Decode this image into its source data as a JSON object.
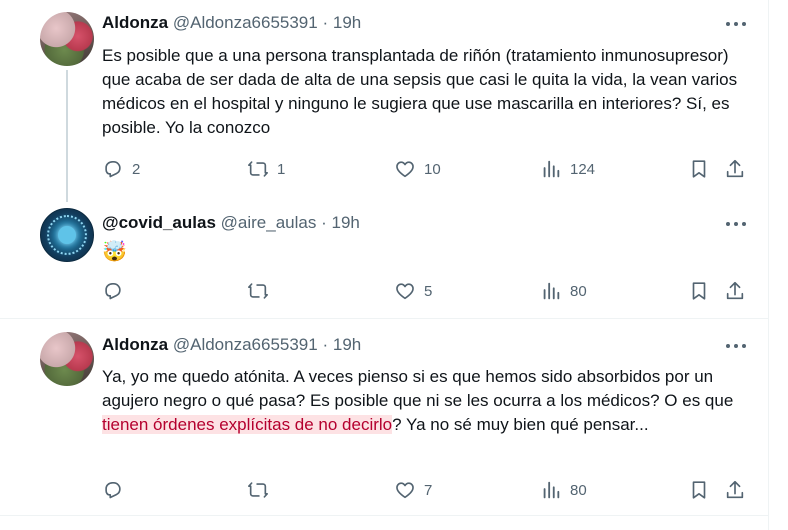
{
  "tweets": [
    {
      "author": "Aldonza",
      "handle": "@Aldonza6655391",
      "separator": "·",
      "time": "19h",
      "text": "Es posible que a una persona transplantada de riñón (tratamiento inmunosupresor) que acaba de ser dada de alta de una sepsis que casi le quita la vida, la vean varios médicos en el hospital y ninguno le sugiera que use mascarilla en interiores? Sí, es posible. Yo la conozco",
      "replies": "2",
      "retweets": "1",
      "likes": "10",
      "views": "124"
    },
    {
      "author": "@covid_aulas",
      "handle": "@aire_aulas",
      "separator": "·",
      "time": "19h",
      "emoji": "🤯",
      "replies": "",
      "retweets": "",
      "likes": "5",
      "views": "80"
    },
    {
      "author": "Aldonza",
      "handle": "@Aldonza6655391",
      "separator": "·",
      "time": "19h",
      "text_before": "Ya, yo me quedo atónita. A veces pienso si es que hemos sido absorbidos por un agujero negro o qué pasa? Es posible que ni se les ocurra a los médicos? O es que ",
      "text_highlight": "tienen órdenes explícitas de no decirlo",
      "text_after": "? Ya no sé muy bien qué pensar...",
      "replies": "",
      "retweets": "",
      "likes": "7",
      "views": "80"
    }
  ],
  "icons": {
    "reply": "reply-icon",
    "retweet": "retweet-icon",
    "like": "heart-icon",
    "views": "views-icon",
    "bookmark": "bookmark-icon",
    "share": "share-icon",
    "more": "more-icon"
  },
  "colors": {
    "text": "#0f1419",
    "secondary": "#536471",
    "highlight_bg": "#fde2e4",
    "highlight_text": "#b4002e",
    "thread_line": "#cfd9de"
  }
}
